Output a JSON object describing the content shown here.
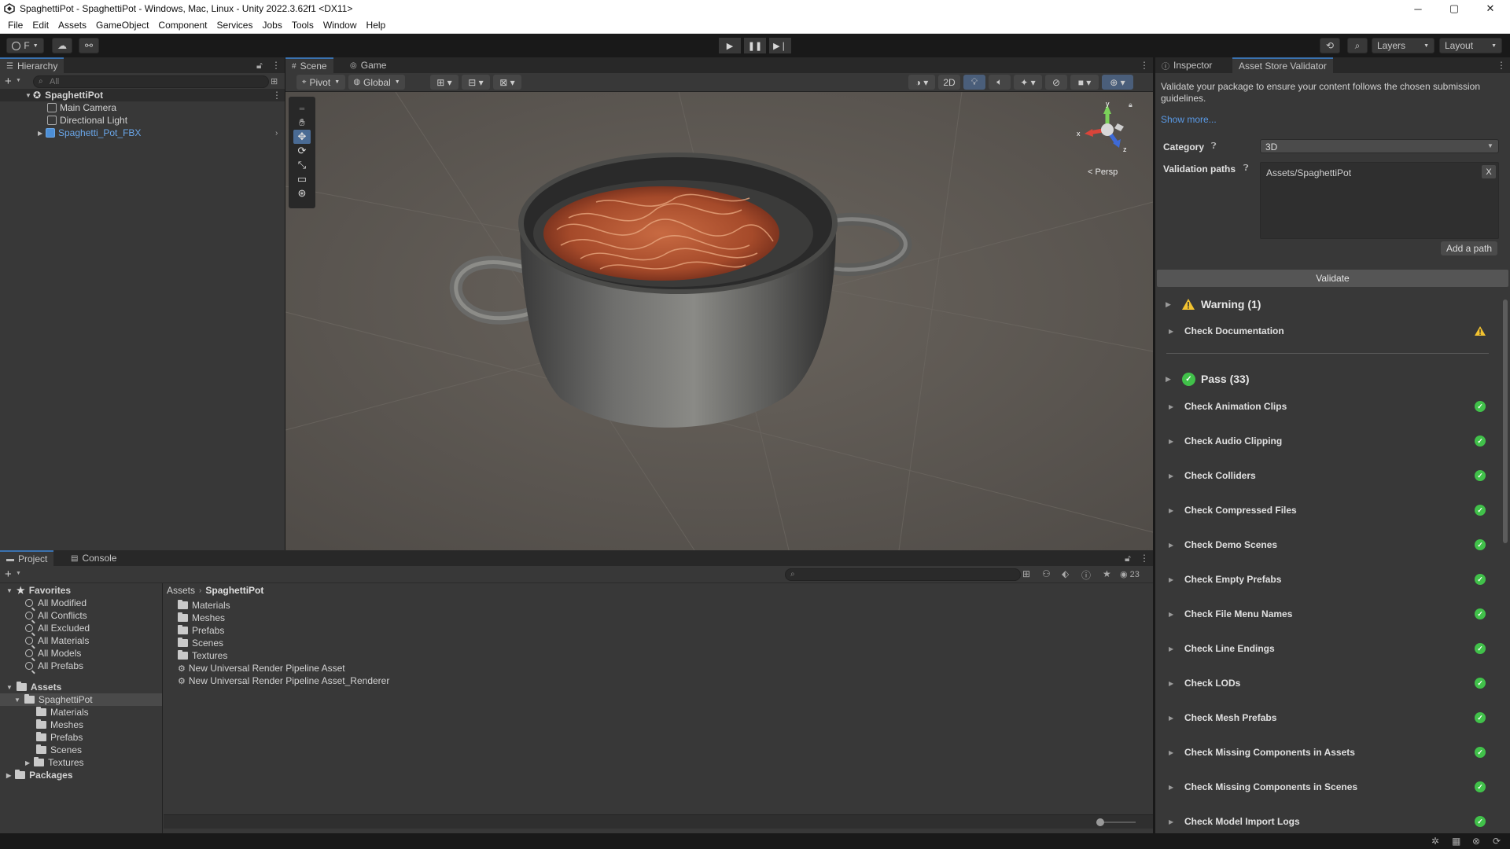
{
  "window": {
    "title": "SpaghettiPot - SpaghettiPot - Windows, Mac, Linux - Unity 2022.3.62f1 <DX11>",
    "minimize": "─",
    "maximize": "▢",
    "close": "✕"
  },
  "menu": [
    "File",
    "Edit",
    "Assets",
    "GameObject",
    "Component",
    "Services",
    "Jobs",
    "Tools",
    "Window",
    "Help"
  ],
  "toolbar": {
    "account_label": "F",
    "layers_label": "Layers",
    "layout_label": "Layout"
  },
  "hierarchy": {
    "tab": "Hierarchy",
    "search_placeholder": "All",
    "scene_name": "SpaghettiPot",
    "items": [
      "Main Camera",
      "Directional Light",
      "Spaghetti_Pot_FBX"
    ]
  },
  "scene": {
    "tabs": [
      "Scene",
      "Game"
    ],
    "pivot_label": "Pivot",
    "global_label": "Global",
    "mode_2d": "2D",
    "persp_label": "< Persp",
    "gizmo_axes": {
      "y": "y",
      "x": "x",
      "z": "z"
    }
  },
  "inspector": {
    "tabs": [
      "Inspector",
      "Asset Store Validator"
    ],
    "description": "Validate your package to ensure your content follows the chosen submission guidelines.",
    "show_more": "Show more...",
    "category_label": "Category",
    "category_value": "3D",
    "paths_label": "Validation paths",
    "path_value": "Assets/SpaghettiPot",
    "remove_path": "X",
    "add_path": "Add a path",
    "validate": "Validate",
    "warning_header": "Warning (1)",
    "warning_items": [
      "Check Documentation"
    ],
    "pass_header": "Pass (33)",
    "pass_items": [
      "Check Animation Clips",
      "Check Audio Clipping",
      "Check Colliders",
      "Check Compressed Files",
      "Check Demo Scenes",
      "Check Empty Prefabs",
      "Check File Menu Names",
      "Check Line Endings",
      "Check LODs",
      "Check Mesh Prefabs",
      "Check Missing Components in Assets",
      "Check Missing Components in Scenes",
      "Check Model Import Logs"
    ]
  },
  "project": {
    "tabs": [
      "Project",
      "Console"
    ],
    "favorites_label": "Favorites",
    "favorites": [
      "All Modified",
      "All Conflicts",
      "All Excluded",
      "All Materials",
      "All Models",
      "All Prefabs"
    ],
    "assets_label": "Assets",
    "spaghetti_folder": "SpaghettiPot",
    "subfolders": [
      "Materials",
      "Meshes",
      "Prefabs",
      "Scenes",
      "Textures"
    ],
    "packages_label": "Packages",
    "breadcrumb_root": "Assets",
    "breadcrumb_current": "SpaghettiPot",
    "content_folders": [
      "Materials",
      "Meshes",
      "Prefabs",
      "Scenes",
      "Textures"
    ],
    "content_assets": [
      "New Universal Render Pipeline Asset",
      "New Universal Render Pipeline Asset_Renderer"
    ],
    "hidden_count": "23"
  }
}
